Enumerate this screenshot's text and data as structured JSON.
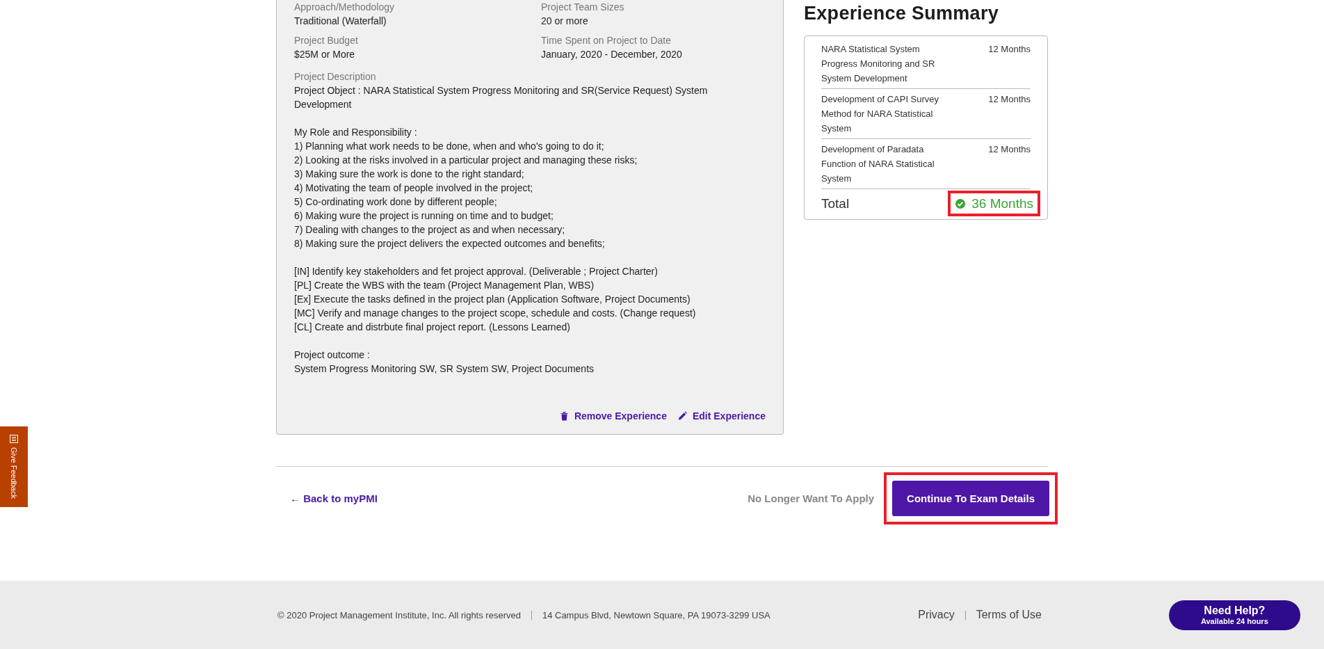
{
  "experience_card": {
    "fields": [
      {
        "label": "Approach/Methodology",
        "value": "Traditional (Waterfall)"
      },
      {
        "label": "Project Team Sizes",
        "value": "20 or more"
      },
      {
        "label": "Project Budget",
        "value": "$25M or More"
      },
      {
        "label": "Time Spent on Project to Date",
        "value": "January, 2020 - December, 2020"
      }
    ],
    "description_label": "Project Description",
    "description": [
      [
        "Project Object : NARA Statistical System Progress Monitoring and SR(Service Request) System Development"
      ],
      [
        "My Role and Responsibility :",
        "1) Planning what work needs to be done, when and who's going to do it;",
        "2) Looking at the risks involved in a particular project and managing these risks;",
        "3) Making sure the work is done to the right standard;",
        "4) Motivating the team of people involved in the project;",
        "5) Co-ordinating work done by different people;",
        "6) Making wure the project is running on time and to budget;",
        "7) Dealing with changes to the project as and when necessary;",
        "8) Making sure the project delivers the expected outcomes and benefits;"
      ],
      [
        "[IN] Identify key stakeholders and fet project approval. (Deliverable ; Project Charter)",
        "[PL] Create the WBS with the team (Project Management Plan, WBS)",
        "[Ex] Execute the tasks defined in the project plan (Application Software, Project Documents)",
        "[MC] Verify and manage changes to the project scope, schedule and costs. (Change request)",
        "[CL] Create and distrbute final project report. (Lessons Learned)"
      ],
      [
        "Project outcome :",
        "System Progress Monitoring SW, SR System SW, Project Documents"
      ]
    ],
    "actions": [
      {
        "kind": "remove",
        "label": "Remove Experience"
      },
      {
        "kind": "edit",
        "label": "Edit Experience"
      }
    ]
  },
  "summary": {
    "title": "Experience Summary",
    "rows": [
      {
        "name": "NARA Statistical System Progress Monitoring and SR System Development",
        "duration": "12 Months"
      },
      {
        "name": "Development of CAPI Survey Method for NARA Statistical System",
        "duration": "12 Months"
      },
      {
        "name": "Development of Paradata Function of NARA Statistical System",
        "duration": "12 Months"
      }
    ],
    "total_label": "Total",
    "total_value": "36 Months",
    "total_highlighted": true
  },
  "nav": {
    "back": "← Back to myPMI",
    "withdraw": "No Longer Want To Apply",
    "continue": "Continue To Exam Details",
    "continue_highlighted": true
  },
  "feedback_tab": "Give Feedback",
  "footer": {
    "copyright": "© 2020 Project Management Institute, Inc. All rights reserved",
    "address": "14 Campus Blvd, Newtown Square, PA 19073-3299 USA",
    "links": [
      "Privacy",
      "Terms of Use"
    ],
    "help_title": "Need Help?",
    "help_subtitle": "Available 24 hours"
  }
}
